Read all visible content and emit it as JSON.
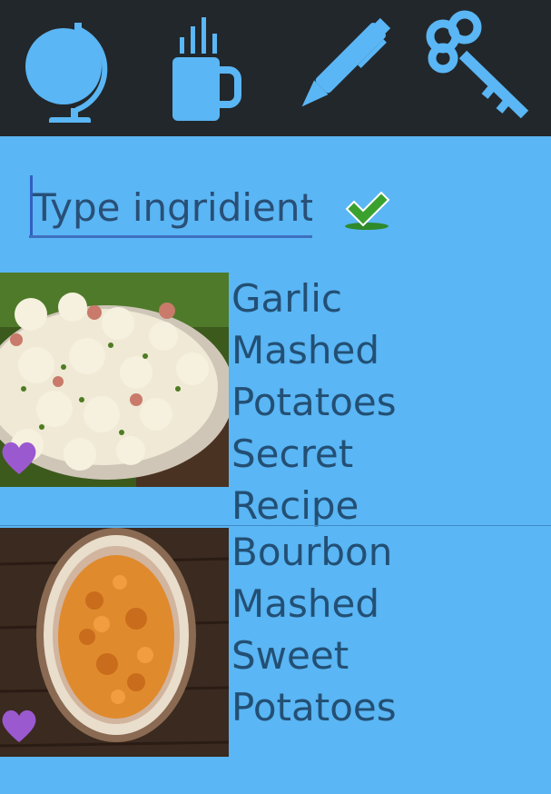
{
  "toolbar": {
    "tabs": [
      {
        "icon": "globe-icon"
      },
      {
        "icon": "mug-icon"
      },
      {
        "icon": "pen-icon"
      },
      {
        "icon": "key-icon"
      }
    ],
    "icon_color": "#5ab6f4",
    "background": "#22272b"
  },
  "search": {
    "placeholder": "Type ingridient",
    "value": "",
    "confirm_icon": "checkmark-icon"
  },
  "recipes": [
    {
      "title": "Garlic Mashed Potatoes Secret Recipe",
      "image": "potato-salad-photo",
      "favorite_icon": "heart-icon"
    },
    {
      "title": "Bourbon Mashed Sweet Potatoes",
      "image": "sweet-potato-mash-photo",
      "favorite_icon": "heart-icon"
    }
  ],
  "colors": {
    "background": "#5ab6f4",
    "text": "#234f74",
    "heart": "#9b59d0",
    "check": "#3a9a2a"
  }
}
